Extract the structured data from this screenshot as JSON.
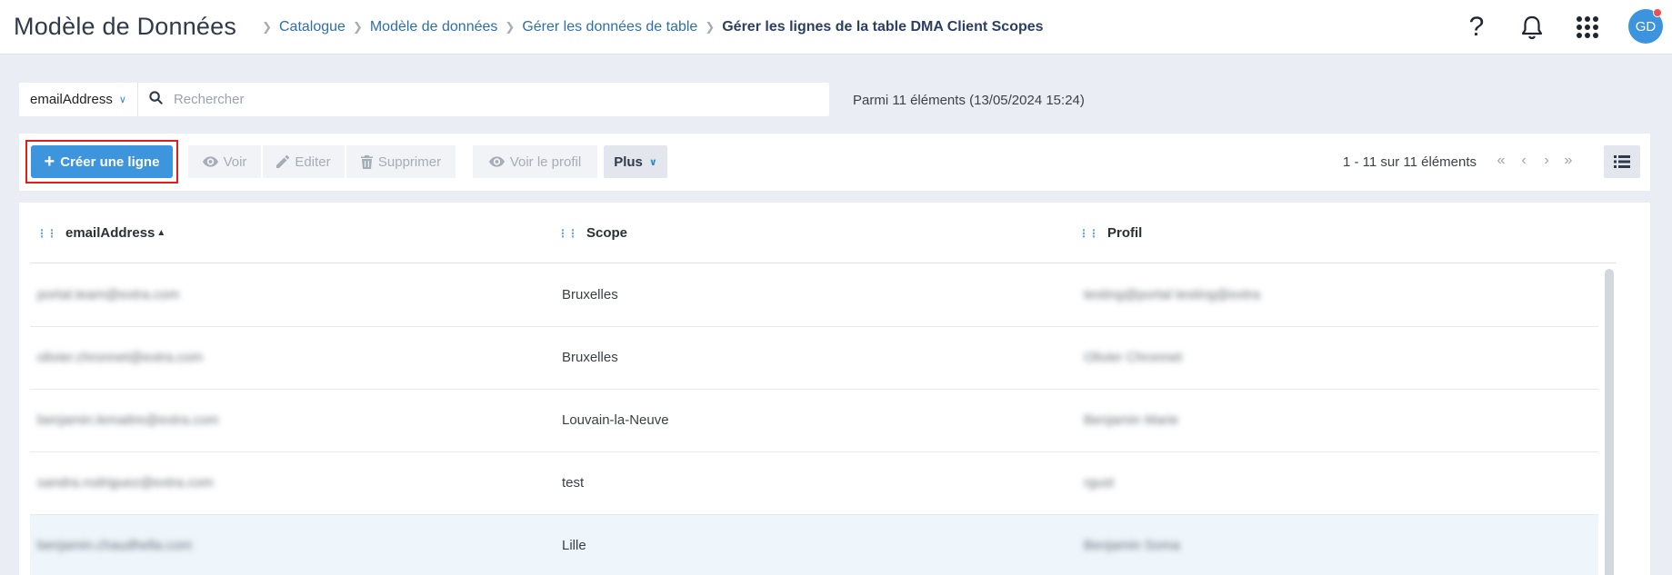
{
  "header": {
    "title": "Modèle de Données",
    "breadcrumb": [
      "Catalogue",
      "Modèle de données",
      "Gérer les données de table",
      "Gérer les lignes de la table DMA Client Scopes"
    ],
    "help_symbol": "?",
    "avatar_initials": "GD"
  },
  "search": {
    "field": "emailAddress",
    "placeholder": "Rechercher",
    "count_info": "Parmi 11 éléments (13/05/2024 15:24)"
  },
  "toolbar": {
    "create_label": "Créer une ligne",
    "view_label": "Voir",
    "edit_label": "Editer",
    "delete_label": "Supprimer",
    "view_profile_label": "Voir le profil",
    "more_label": "Plus",
    "pagination": "1 - 11 sur 11 éléments"
  },
  "table": {
    "columns": [
      "emailAddress",
      "Scope",
      "Profil"
    ],
    "rows": [
      {
        "email": "portal.team@extra.com",
        "scope": "Bruxelles",
        "profile": "testing@portal testing@extra"
      },
      {
        "email": "olivier.chronnet@extra.com",
        "scope": "Bruxelles",
        "profile": "Olivier Chronnet"
      },
      {
        "email": "benjamin.lemaitre@extra.com",
        "scope": "Louvain-la-Neuve",
        "profile": "Benjamin Marie"
      },
      {
        "email": "sandra.rodriguez@extra.com",
        "scope": "test",
        "profile": "rgust"
      },
      {
        "email": "benjamin.chaudhella.com",
        "scope": "Lille",
        "profile": "Benjamin Soma"
      }
    ]
  },
  "colors": {
    "accent": "#3d95de",
    "highlight_border": "#e01e1e",
    "page_background": "#eaeef4",
    "notification_dot": "#ef4d57"
  }
}
